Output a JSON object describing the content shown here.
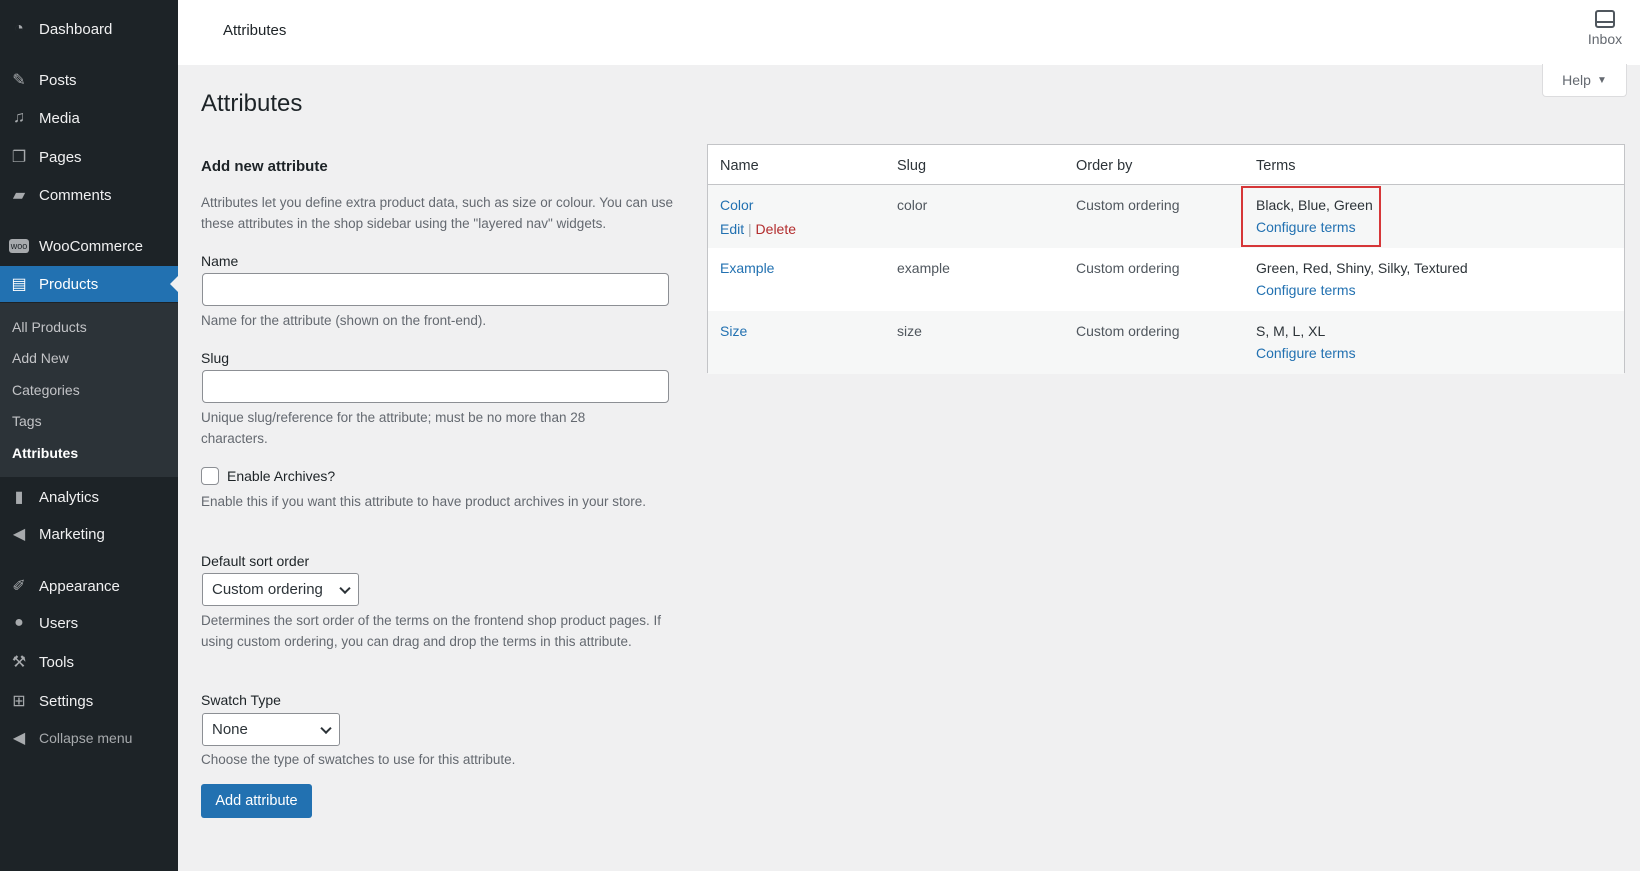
{
  "sidebar": {
    "items": [
      {
        "label": "Dashboard",
        "icon": "dashboard-icon"
      },
      {
        "label": "Posts",
        "icon": "pin-icon"
      },
      {
        "label": "Media",
        "icon": "media-icon"
      },
      {
        "label": "Pages",
        "icon": "pages-icon"
      },
      {
        "label": "Comments",
        "icon": "comment-icon"
      },
      {
        "label": "WooCommerce",
        "icon": "woo-icon"
      },
      {
        "label": "Products",
        "icon": "archive-icon"
      },
      {
        "label": "Analytics",
        "icon": "chart-icon"
      },
      {
        "label": "Marketing",
        "icon": "megaphone-icon"
      },
      {
        "label": "Appearance",
        "icon": "brush-icon"
      },
      {
        "label": "Users",
        "icon": "user-icon"
      },
      {
        "label": "Tools",
        "icon": "wrench-icon"
      },
      {
        "label": "Settings",
        "icon": "settings-icon"
      },
      {
        "label": "Collapse menu",
        "icon": "collapse-icon"
      }
    ],
    "submenu": [
      "All Products",
      "Add New",
      "Categories",
      "Tags",
      "Attributes"
    ]
  },
  "header": {
    "title": "Attributes",
    "inbox_label": "Inbox",
    "help_label": "Help"
  },
  "page_title": "Attributes",
  "form": {
    "heading": "Add new attribute",
    "intro": "Attributes let you define extra product data, such as size or colour. You can use these attributes in the shop sidebar using the \"layered nav\" widgets.",
    "name_label": "Name",
    "name_value": "",
    "name_help": "Name for the attribute (shown on the front-end).",
    "slug_label": "Slug",
    "slug_value": "",
    "slug_help": "Unique slug/reference for the attribute; must be no more than 28 characters.",
    "archives_label": "Enable Archives?",
    "archives_checked": false,
    "archives_help": "Enable this if you want this attribute to have product archives in your store.",
    "sort_label": "Default sort order",
    "sort_value": "Custom ordering",
    "sort_help": "Determines the sort order of the terms on the frontend shop product pages. If using custom ordering, you can drag and drop the terms in this attribute.",
    "swatch_label": "Swatch Type",
    "swatch_value": "None",
    "swatch_help": "Choose the type of swatches to use for this attribute.",
    "submit": "Add attribute"
  },
  "table": {
    "headers": [
      "Name",
      "Slug",
      "Order by",
      "Terms"
    ],
    "edit": "Edit",
    "sep": "|",
    "delete": "Delete",
    "configure": "Configure terms",
    "rows": [
      {
        "name": "Color",
        "slug": "color",
        "order": "Custom ordering",
        "terms": "Black, Blue, Green"
      },
      {
        "name": "Example",
        "slug": "example",
        "order": "Custom ordering",
        "terms": "Green, Red, Shiny, Silky, Textured"
      },
      {
        "name": "Size",
        "slug": "size",
        "order": "Custom ordering",
        "terms": "S, M, L, XL"
      }
    ]
  },
  "colors": {
    "accent": "#2271b1",
    "sidebar": "#1d2327",
    "highlight_box": "#d63638",
    "delete": "#b32d2e"
  }
}
